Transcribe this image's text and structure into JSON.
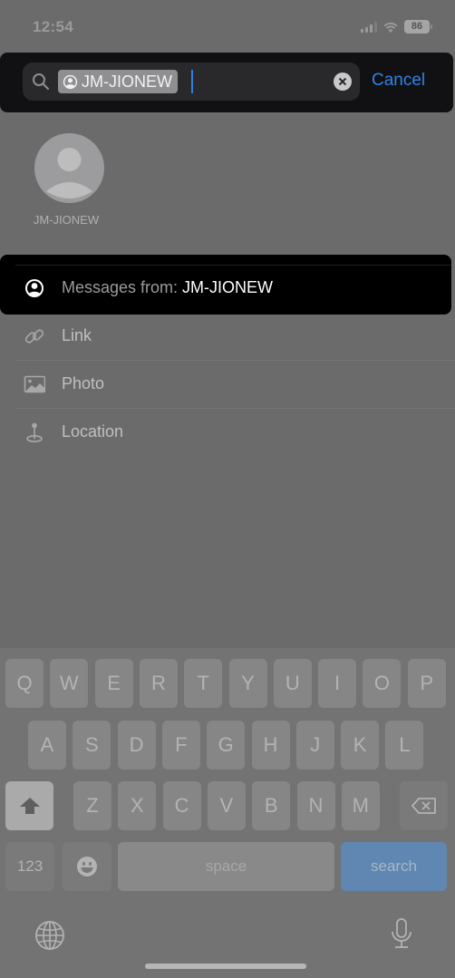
{
  "status_bar": {
    "time": "12:54",
    "battery": "86"
  },
  "search": {
    "token_label": "JM-JIONEW",
    "cancel_label": "Cancel"
  },
  "contact": {
    "name": "JM-JIONEW"
  },
  "suggestions": [
    {
      "prefix": "Messages from: ",
      "value": "JM-JIONEW",
      "icon": "person-circle-icon"
    },
    {
      "label": "Link",
      "icon": "link-icon"
    },
    {
      "label": "Photo",
      "icon": "photo-icon"
    },
    {
      "label": "Location",
      "icon": "location-pin-icon"
    }
  ],
  "keyboard": {
    "row1": [
      "Q",
      "W",
      "E",
      "R",
      "T",
      "Y",
      "U",
      "I",
      "O",
      "P"
    ],
    "row2": [
      "A",
      "S",
      "D",
      "F",
      "G",
      "H",
      "J",
      "K",
      "L"
    ],
    "row3": [
      "Z",
      "X",
      "C",
      "V",
      "B",
      "N",
      "M"
    ],
    "numbers_label": "123",
    "space_label": "space",
    "search_label": "search",
    "search_color": "#5f87b2"
  },
  "colors": {
    "accent": "#2f83e6",
    "caret": "#2f7de1"
  }
}
